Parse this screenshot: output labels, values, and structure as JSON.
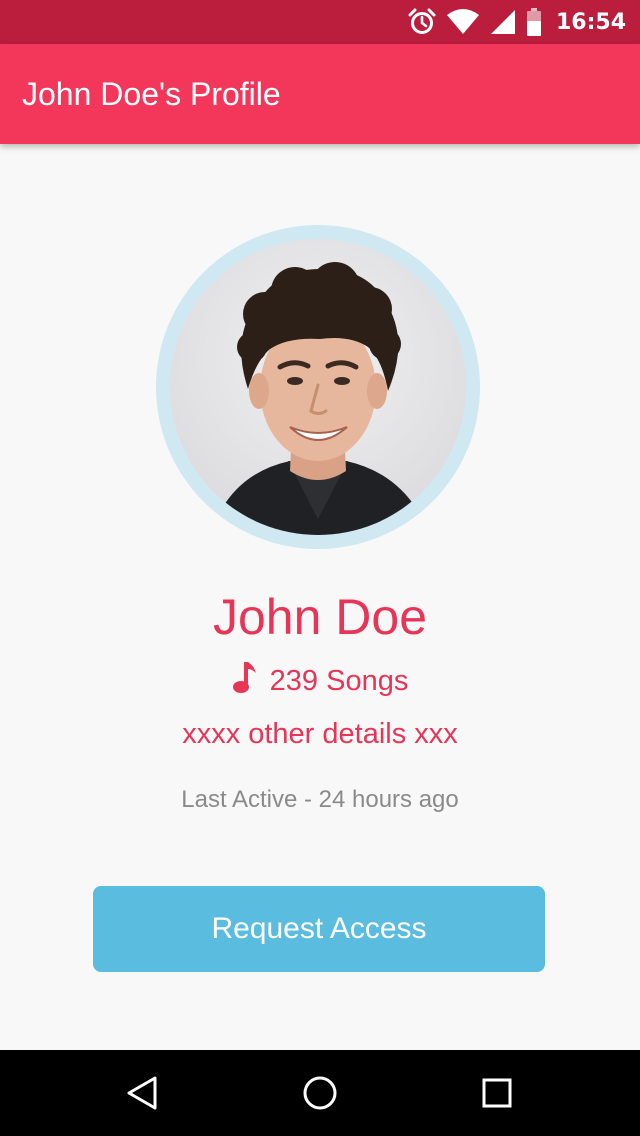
{
  "status_bar": {
    "time": "16:54",
    "icons": [
      "alarm-icon",
      "wifi-icon",
      "signal-icon",
      "battery-icon"
    ]
  },
  "app_bar": {
    "title": "John Doe's Profile"
  },
  "profile": {
    "name": "John Doe",
    "songs_icon": "music-note-icon",
    "songs": "239 Songs",
    "details": "xxxx other details xxx",
    "last_active": "Last Active - 24 hours ago",
    "request_button_label": "Request Access"
  },
  "nav_bar": {
    "buttons": [
      "back-icon",
      "home-icon",
      "recents-icon"
    ]
  },
  "colors": {
    "status_bar": "#bb1d3d",
    "app_bar": "#f3375a",
    "accent_text": "#e73558",
    "button": "#5abcdf",
    "avatar_ring": "#cfe8f2",
    "muted_text": "#8a8a8a"
  }
}
